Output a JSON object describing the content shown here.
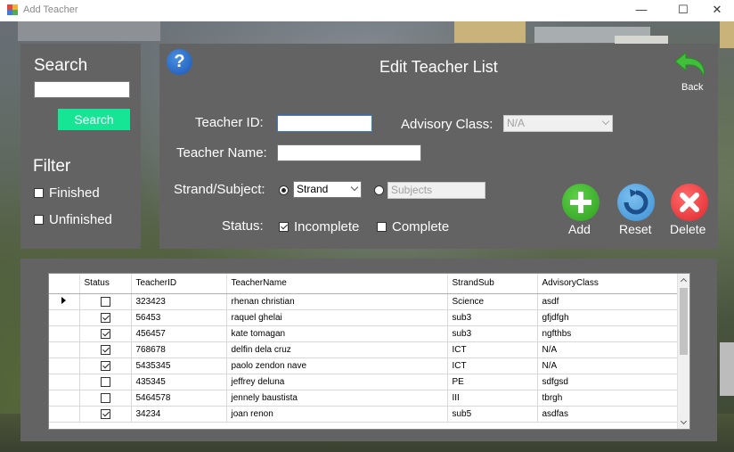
{
  "window": {
    "title": "Add Teacher",
    "controls": {
      "minimize": "—",
      "maximize": "☐",
      "close": "✕"
    }
  },
  "search_panel": {
    "title": "Search",
    "input_value": "",
    "button_label": "Search",
    "button_color": "#17e596",
    "filter_title": "Filter",
    "filters": [
      {
        "label": "Finished",
        "checked": false
      },
      {
        "label": "Unfinished",
        "checked": false
      }
    ]
  },
  "form": {
    "help_icon": "?",
    "title": "Edit Teacher List",
    "back_label": "Back",
    "teacher_id_label": "Teacher ID:",
    "teacher_id_value": "",
    "advisory_label": "Advisory Class:",
    "advisory_value": "N/A",
    "teacher_name_label": "Teacher Name:",
    "teacher_name_value": "",
    "strand_subject_label": "Strand/Subject:",
    "strand_option_value": "Strand",
    "subjects_placeholder": "Subjects",
    "status_label": "Status:",
    "status_incomplete": "Incomplete",
    "status_complete": "Complete"
  },
  "actions": {
    "add_label": "Add",
    "reset_label": "Reset",
    "delete_label": "Delete",
    "add_color": "#2e9e1f",
    "reset_color": "#3d8fd6",
    "delete_color": "#e0262b"
  },
  "grid": {
    "columns": [
      "Status",
      "TeacherID",
      "TeacherName",
      "StrandSub",
      "AdvisoryClass"
    ],
    "rows": [
      {
        "checked": false,
        "id": "323423",
        "name": "rhenan christian",
        "strand": "Science",
        "advisory": "asdf",
        "current": true
      },
      {
        "checked": true,
        "id": "56453",
        "name": "raquel ghelai",
        "strand": "sub3",
        "advisory": "gfjdfgh"
      },
      {
        "checked": true,
        "id": "456457",
        "name": "kate tomagan",
        "strand": "sub3",
        "advisory": "ngfthbs"
      },
      {
        "checked": true,
        "id": "768678",
        "name": "delfin dela cruz",
        "strand": "ICT",
        "advisory": "N/A"
      },
      {
        "checked": true,
        "id": "5435345",
        "name": "paolo zendon nave",
        "strand": "ICT",
        "advisory": "N/A"
      },
      {
        "checked": false,
        "id": "435345",
        "name": "jeffrey deluna",
        "strand": "PE",
        "advisory": "sdfgsd"
      },
      {
        "checked": false,
        "id": "5464578",
        "name": "jennely baustista",
        "strand": "III",
        "advisory": "tbrgh"
      },
      {
        "checked": true,
        "id": "34234",
        "name": "joan renon",
        "strand": "sub5",
        "advisory": "asdfas"
      }
    ]
  }
}
